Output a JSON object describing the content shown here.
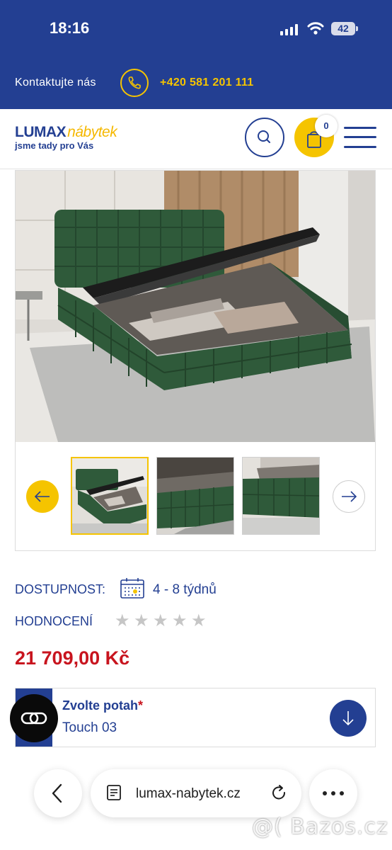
{
  "status_bar": {
    "time": "18:16",
    "battery": "42"
  },
  "contact_bar": {
    "label": "Kontaktujte nás",
    "phone": "+420 581 201 111"
  },
  "header": {
    "logo_main": "LUMAX",
    "logo_accent": "nábytek",
    "tagline": "jsme tady pro Vás",
    "cart_count": "0",
    "icons": [
      "search-icon",
      "shopping-bag-icon",
      "hamburger-menu-icon"
    ]
  },
  "gallery": {
    "main_image": "green upholstered bed with lifted storage base",
    "thumbnail_count": 3,
    "active_thumbnail": 1
  },
  "product": {
    "availability_label": "DOSTUPNOST:",
    "availability_value": "4 - 8 týdnů",
    "rating_label": "HODNOCENÍ",
    "rating_stars": 0,
    "rating_max": 5,
    "price": "21 709,00 Kč"
  },
  "cover_select": {
    "title": "Zvolte potah",
    "required_mark": "*",
    "value": "Touch 03"
  },
  "browser": {
    "url": "lumax-nabytek.cz"
  },
  "watermark": "@( Bazos.cz",
  "colors": {
    "brand_blue": "#233f92",
    "accent_yellow": "#f5c400",
    "price_red": "#c8141e"
  }
}
